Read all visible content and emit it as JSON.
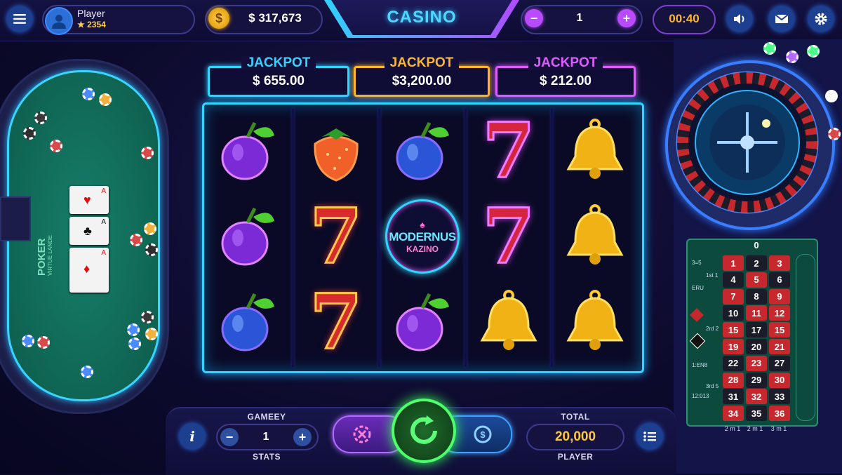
{
  "topbar": {
    "player_name": "Player",
    "player_points": "2354",
    "balance": "$ 317,673",
    "title": "CASINO",
    "bet_count": "1",
    "timer": "00:40",
    "minus": "−",
    "plus": "+"
  },
  "jackpots": [
    {
      "label": "JACKPOT",
      "value": "$ 655.00",
      "color": "#35d4ff"
    },
    {
      "label": "JACKPOT",
      "value": "$3,200.00",
      "color": "#ffb52e"
    },
    {
      "label": "JACKPOT",
      "value": "$ 212.00",
      "color": "#e05cff"
    }
  ],
  "reels": {
    "logo_main": "MODERNUS",
    "logo_sub": "KAZINO",
    "symbols": [
      [
        "plum-purple",
        "plum-purple",
        "plum-blue"
      ],
      [
        "strawberry",
        "seven-red",
        "seven-red"
      ],
      [
        "plum-blue",
        "logo",
        "plum-purple"
      ],
      [
        "seven-pink",
        "seven-pink",
        "bell"
      ],
      [
        "bell",
        "bell",
        "bell"
      ]
    ],
    "seven_glyph": "7"
  },
  "poker": {
    "label": "POKER",
    "sublabel": "VIRTUE LANDE",
    "cards": [
      {
        "rank": "A",
        "suit": "♥",
        "color": "#d11"
      },
      {
        "rank": "A",
        "suit": "♣",
        "color": "#111"
      },
      {
        "rank": "A",
        "suit": "♦",
        "color": "#d11"
      }
    ]
  },
  "roulette": {
    "zero": "0",
    "numbers": [
      [
        "1",
        "2",
        "3"
      ],
      [
        "4",
        "5",
        "6"
      ],
      [
        "7",
        "8",
        "9"
      ],
      [
        "10",
        "11",
        "12"
      ],
      [
        "15",
        "17",
        "15"
      ],
      [
        "19",
        "20",
        "21"
      ],
      [
        "22",
        "23",
        "27"
      ],
      [
        "28",
        "29",
        "30"
      ],
      [
        "31",
        "32",
        "33"
      ],
      [
        "34",
        "35",
        "36"
      ]
    ],
    "colors": [
      [
        "red",
        "black",
        "red"
      ],
      [
        "black",
        "red",
        "black"
      ],
      [
        "red",
        "black",
        "red"
      ],
      [
        "black",
        "red",
        "red"
      ],
      [
        "red",
        "black",
        "red"
      ],
      [
        "red",
        "black",
        "red"
      ],
      [
        "black",
        "red",
        "black"
      ],
      [
        "red",
        "black",
        "red"
      ],
      [
        "black",
        "red",
        "black"
      ],
      [
        "red",
        "black",
        "red"
      ]
    ],
    "dozens": [
      "1st 1",
      "2rd 2",
      "3rd 5"
    ],
    "side_labels": [
      "3=5",
      "ERU",
      "1:EN8",
      "12:013"
    ],
    "columns": [
      "2 m 1",
      "2 m 1",
      "3 m 1"
    ]
  },
  "bottom": {
    "info": "i",
    "game_label": "GAMEEY",
    "game_value": "1",
    "stats_label": "STATS",
    "total_label": "TOTAL",
    "total_value": "20,000",
    "player_label": "PLAYER"
  }
}
